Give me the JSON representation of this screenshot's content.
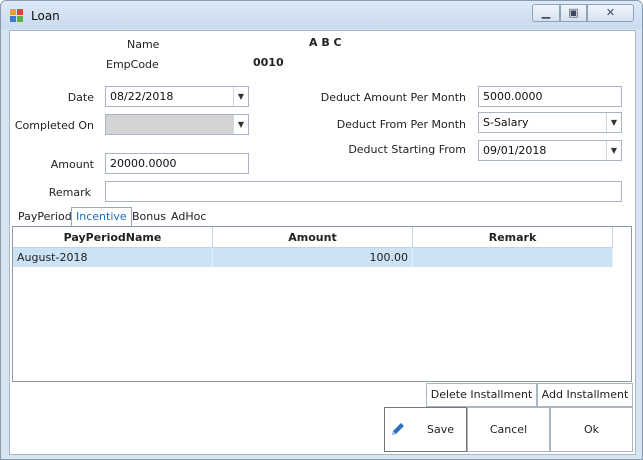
{
  "window": {
    "title": "Loan"
  },
  "employee": {
    "name_label": "Name",
    "name_value": "A B C",
    "code_label": "EmpCode",
    "code_value": "0010"
  },
  "form": {
    "date_label": "Date",
    "date_value": "08/22/2018",
    "completed_on_label": "Completed On",
    "completed_on_value": "",
    "amount_label": "Amount",
    "amount_value": "20000.0000",
    "remark_label": "Remark",
    "remark_value": "",
    "deduct_amount_label": "Deduct Amount Per Month",
    "deduct_amount_value": "5000.0000",
    "deduct_from_label": "Deduct From Per Month",
    "deduct_from_value": "S-Salary",
    "deduct_start_label": "Deduct Starting From",
    "deduct_start_value": "09/01/2018"
  },
  "tabs": [
    {
      "label": "PayPeriod",
      "active": false
    },
    {
      "label": "Incentive",
      "active": true
    },
    {
      "label": "Bonus",
      "active": false
    },
    {
      "label": "AdHoc",
      "active": false
    }
  ],
  "grid": {
    "columns": [
      "PayPeriodName",
      "Amount",
      "Remark"
    ],
    "rows": [
      {
        "pay_period": "August-2018",
        "amount": "100.00",
        "remark": ""
      }
    ]
  },
  "buttons": {
    "delete_installment": "Delete Installment",
    "add_installment": "Add Installment",
    "save": "Save",
    "cancel": "Cancel",
    "ok": "Ok"
  },
  "icons": {
    "app": "form-icon",
    "save": "pencil-icon"
  }
}
